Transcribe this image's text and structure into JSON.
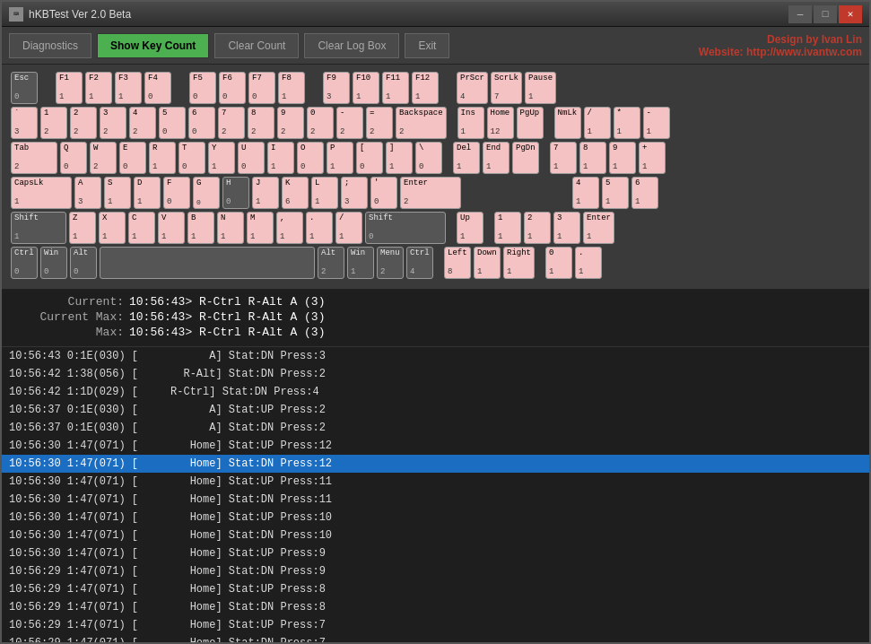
{
  "titleBar": {
    "title": "hKBTest Ver 2.0 Beta",
    "minBtn": "—",
    "maxBtn": "□",
    "closeBtn": "✕"
  },
  "toolbar": {
    "diagnosticsLabel": "Diagnostics",
    "showKeyCountLabel": "Show Key Count",
    "clearCountLabel": "Clear Count",
    "clearLogBoxLabel": "Clear Log Box",
    "exitLabel": "Exit",
    "designLine1": "Design by Ivan Lin",
    "designLine2": "Website: http://www.ivantw.com"
  },
  "keyboard": {
    "rows": [
      [
        {
          "label": "Esc",
          "count": "0",
          "width": "normal"
        },
        {
          "label": "",
          "count": "",
          "width": "gap"
        },
        {
          "label": "F1",
          "count": "1",
          "width": "normal"
        },
        {
          "label": "F2",
          "count": "1",
          "width": "normal"
        },
        {
          "label": "F3",
          "count": "1",
          "width": "normal"
        },
        {
          "label": "F4",
          "count": "0",
          "width": "normal"
        },
        {
          "label": "",
          "count": "",
          "width": "gap"
        },
        {
          "label": "F5",
          "count": "0",
          "width": "normal"
        },
        {
          "label": "F6",
          "count": "0",
          "width": "normal"
        },
        {
          "label": "F7",
          "count": "0",
          "width": "normal"
        },
        {
          "label": "F8",
          "count": "1",
          "width": "normal"
        },
        {
          "label": "",
          "count": "",
          "width": "gap"
        },
        {
          "label": "F9",
          "count": "3",
          "width": "normal"
        },
        {
          "label": "F10",
          "count": "1",
          "width": "normal"
        },
        {
          "label": "F11",
          "count": "1",
          "width": "normal"
        },
        {
          "label": "F12",
          "count": "1",
          "width": "normal"
        },
        {
          "label": "",
          "count": "",
          "width": "gap"
        },
        {
          "label": "PrScr",
          "count": "4",
          "width": "normal"
        },
        {
          "label": "ScrLk",
          "count": "7",
          "width": "normal"
        },
        {
          "label": "Pause",
          "count": "1",
          "width": "normal"
        }
      ]
    ]
  },
  "statusArea": {
    "current": {
      "label": "Current:",
      "value": "10:56:43> R-Ctrl R-Alt A (3)"
    },
    "currentMax": {
      "label": "Current Max:",
      "value": "10:56:43> R-Ctrl R-Alt A (3)"
    },
    "max": {
      "label": "Max:",
      "value": "10:56:43> R-Ctrl R-Alt A (3)"
    }
  },
  "logEntries": [
    {
      "text": "10:56:43 0:1E(030) [           A] Stat:DN Press:3",
      "highlighted": false
    },
    {
      "text": "10:56:42 1:38(056) [       R-Alt] Stat:DN Press:2",
      "highlighted": false
    },
    {
      "text": "10:56:42 1:1D(029) [     R-Ctrl] Stat:DN Press:4",
      "highlighted": false
    },
    {
      "text": "10:56:37 0:1E(030) [           A] Stat:UP Press:2",
      "highlighted": false
    },
    {
      "text": "10:56:37 0:1E(030) [           A] Stat:DN Press:2",
      "highlighted": false
    },
    {
      "text": "10:56:30 1:47(071) [        Home] Stat:UP Press:12",
      "highlighted": false
    },
    {
      "text": "10:56:30 1:47(071) [        Home] Stat:DN Press:12",
      "highlighted": true
    },
    {
      "text": "10:56:30 1:47(071) [        Home] Stat:UP Press:11",
      "highlighted": false
    },
    {
      "text": "10:56:30 1:47(071) [        Home] Stat:DN Press:11",
      "highlighted": false
    },
    {
      "text": "10:56:30 1:47(071) [        Home] Stat:UP Press:10",
      "highlighted": false
    },
    {
      "text": "10:56:30 1:47(071) [        Home] Stat:DN Press:10",
      "highlighted": false
    },
    {
      "text": "10:56:30 1:47(071) [        Home] Stat:UP Press:9",
      "highlighted": false
    },
    {
      "text": "10:56:29 1:47(071) [        Home] Stat:DN Press:9",
      "highlighted": false
    },
    {
      "text": "10:56:29 1:47(071) [        Home] Stat:UP Press:8",
      "highlighted": false
    },
    {
      "text": "10:56:29 1:47(071) [        Home] Stat:DN Press:8",
      "highlighted": false
    },
    {
      "text": "10:56:29 1:47(071) [        Home] Stat:UP Press:7",
      "highlighted": false
    },
    {
      "text": "10:56:29 1:47(071) [        Home] Stat:DN Press:7",
      "highlighted": false
    }
  ]
}
